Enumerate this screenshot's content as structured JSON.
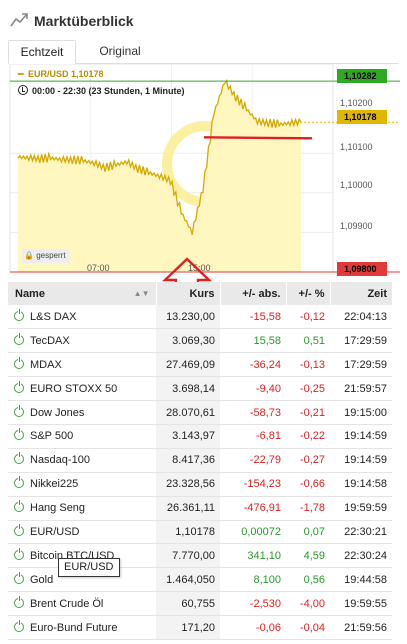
{
  "header": {
    "title": "Marktüberblick",
    "icon": "trend-chart-icon"
  },
  "tabs": [
    {
      "label": "Echtzeit",
      "active": true
    },
    {
      "label": "Original",
      "active": false
    }
  ],
  "chart": {
    "instrument": "EUR/USD",
    "last": "1,10178",
    "timespan": "00:00 - 22:30  (23 Stunden, 1 Minute)",
    "locked_label": "gesperrt",
    "badges": {
      "high": "1,10282",
      "current": "1,10178",
      "low": "1,09800"
    },
    "y_ticks": [
      "1,10200",
      "1,10100",
      "1,10000",
      "1,09900"
    ],
    "x_ticks": [
      "07:00",
      "15:00"
    ],
    "colors": {
      "line": "#d4a900",
      "fill": "#fff6c0",
      "high": "#2fa823",
      "current": "#e0b800",
      "low": "#e03a3a",
      "annotation": "#e02020"
    }
  },
  "chart_data": {
    "type": "line",
    "x": [
      "00:00",
      "01:00",
      "02:00",
      "03:00",
      "04:00",
      "05:00",
      "06:00",
      "07:00",
      "08:00",
      "09:00",
      "10:00",
      "11:00",
      "12:00",
      "13:00",
      "14:00",
      "14:30",
      "15:00",
      "15:30",
      "16:00",
      "16:30",
      "17:00",
      "18:00",
      "19:00",
      "20:00",
      "21:00",
      "22:00",
      "22:30"
    ],
    "values": [
      1.1009,
      1.10088,
      1.10085,
      1.10087,
      1.10084,
      1.10082,
      1.1008,
      1.10075,
      1.10062,
      1.1007,
      1.10078,
      1.1006,
      1.1005,
      1.10042,
      1.1003,
      1.0995,
      1.099,
      1.1001,
      1.102,
      1.10282,
      1.1024,
      1.1021,
      1.1018,
      1.10175,
      1.10172,
      1.10176,
      1.10178
    ],
    "ylim": [
      1.098,
      1.103
    ],
    "y_ticks": [
      1.101,
      1.1,
      1.099,
      1.098
    ],
    "high": 1.10282,
    "current": 1.10178,
    "low": 1.098,
    "xlabel": "",
    "ylabel": "",
    "title": ""
  },
  "table": {
    "headers": {
      "name": "Name",
      "kurs": "Kurs",
      "abs": "+/- abs.",
      "pct": "+/- %",
      "zeit": "Zeit"
    },
    "rows": [
      {
        "name": "L&S DAX",
        "kurs": "13.230,00",
        "abs": "-15,58",
        "pct": "-0,12",
        "zeit": "22:04:13",
        "dir": "neg"
      },
      {
        "name": "TecDAX",
        "kurs": "3.069,30",
        "abs": "15,58",
        "pct": "0,51",
        "zeit": "17:29:59",
        "dir": "pos"
      },
      {
        "name": "MDAX",
        "kurs": "27.469,09",
        "abs": "-36,24",
        "pct": "-0,13",
        "zeit": "17:29:59",
        "dir": "neg"
      },
      {
        "name": "EURO STOXX 50",
        "kurs": "3.698,14",
        "abs": "-9,40",
        "pct": "-0,25",
        "zeit": "21:59:57",
        "dir": "neg"
      },
      {
        "name": "Dow Jones",
        "kurs": "28.070,61",
        "abs": "-58,73",
        "pct": "-0,21",
        "zeit": "19:15:00",
        "dir": "neg"
      },
      {
        "name": "S&P 500",
        "kurs": "3.143,97",
        "abs": "-6,81",
        "pct": "-0,22",
        "zeit": "19:14:59",
        "dir": "neg"
      },
      {
        "name": "Nasdaq-100",
        "kurs": "8.417,36",
        "abs": "-22,79",
        "pct": "-0,27",
        "zeit": "19:14:59",
        "dir": "neg"
      },
      {
        "name": "Nikkei225",
        "kurs": "23.328,56",
        "abs": "-154,23",
        "pct": "-0,66",
        "zeit": "19:14:58",
        "dir": "neg"
      },
      {
        "name": "Hang Seng",
        "kurs": "26.361,11",
        "abs": "-476,91",
        "pct": "-1,78",
        "zeit": "19:59:59",
        "dir": "neg"
      },
      {
        "name": "EUR/USD",
        "kurs": "1,10178",
        "abs": "0,00072",
        "pct": "0,07",
        "zeit": "22:30:21",
        "dir": "pos"
      },
      {
        "name": "Bitcoin BTC/USD",
        "kurs": "7.770,00",
        "abs": "341,10",
        "pct": "4,59",
        "zeit": "22:30:24",
        "dir": "pos"
      },
      {
        "name": "Gold",
        "kurs": "1.464,050",
        "abs": "8,100",
        "pct": "0,56",
        "zeit": "19:44:58",
        "dir": "pos"
      },
      {
        "name": "Brent Crude Öl",
        "kurs": "60,755",
        "abs": "-2,530",
        "pct": "-4,00",
        "zeit": "19:59:55",
        "dir": "neg"
      },
      {
        "name": "Euro-Bund Future",
        "kurs": "171,20",
        "abs": "-0,06",
        "pct": "-0,04",
        "zeit": "21:59:56",
        "dir": "neg"
      }
    ]
  },
  "tooltip": "EUR/USD"
}
